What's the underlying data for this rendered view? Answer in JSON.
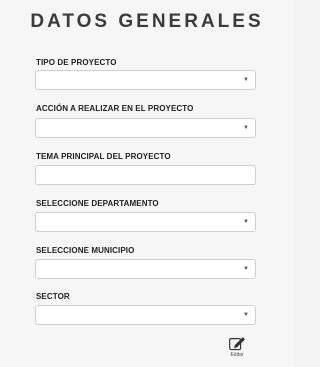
{
  "form": {
    "title": "DATOS GENERALES",
    "fields": [
      {
        "label": "TIPO DE PROYECTO",
        "type": "select",
        "value": ""
      },
      {
        "label": "ACCIÓN A REALIZAR EN EL PROYECTO",
        "type": "select",
        "value": ""
      },
      {
        "label": "TEMA PRINCIPAL DEL PROYECTO",
        "type": "text",
        "value": ""
      },
      {
        "label": "SELECCIONE DEPARTAMENTO",
        "type": "select",
        "value": ""
      },
      {
        "label": "SELECCIONE MUNICIPIO",
        "type": "select",
        "value": ""
      },
      {
        "label": "SECTOR",
        "type": "select",
        "value": ""
      }
    ],
    "caret": "▼",
    "edit_label": "Editar",
    "edit_icon": "edit-pencil-icon"
  }
}
